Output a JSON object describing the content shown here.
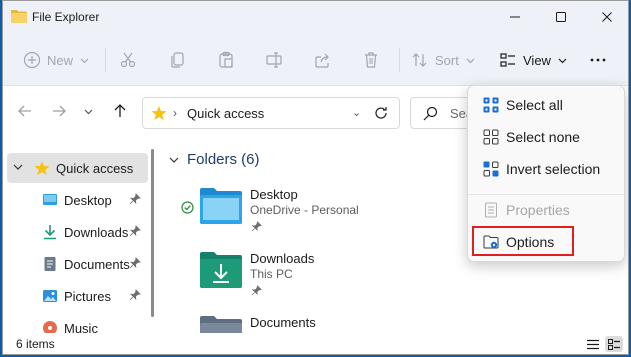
{
  "window": {
    "title": "File Explorer",
    "app_icon": "folder-icon"
  },
  "toolbar": {
    "new_label": "New",
    "sort_label": "Sort",
    "view_label": "View",
    "icons": [
      "cut-icon",
      "copy-icon",
      "paste-icon",
      "rename-icon",
      "share-icon",
      "delete-icon",
      "more-icon"
    ]
  },
  "address": {
    "path": "Quick access",
    "search_placeholder": "Sea"
  },
  "sidebar": {
    "items": [
      {
        "label": "Quick access",
        "icon": "star-icon"
      },
      {
        "label": "Desktop",
        "icon": "desktop-icon"
      },
      {
        "label": "Downloads",
        "icon": "download-icon"
      },
      {
        "label": "Documents",
        "icon": "document-icon"
      },
      {
        "label": "Pictures",
        "icon": "pictures-icon"
      },
      {
        "label": "Music",
        "icon": "music-icon"
      }
    ]
  },
  "content": {
    "section_title": "Folders (6)",
    "folders": [
      {
        "name": "Desktop",
        "sub": "OneDrive - Personal"
      },
      {
        "name": "Downloads",
        "sub": "This PC"
      },
      {
        "name": "Documents",
        "sub": ""
      }
    ]
  },
  "status": {
    "items_count": "6 items"
  },
  "menu": {
    "items": [
      {
        "label": "Select all",
        "icon": "select-all-icon"
      },
      {
        "label": "Select none",
        "icon": "select-none-icon"
      },
      {
        "label": "Invert selection",
        "icon": "invert-selection-icon"
      },
      {
        "label": "Properties",
        "icon": "properties-icon",
        "disabled": true
      },
      {
        "label": "Options",
        "icon": "options-icon",
        "highlighted": true
      }
    ]
  },
  "colors": {
    "accent": "#0067c0",
    "folder_blue": "#2b9fe0",
    "folder_green": "#1d9a77",
    "star": "#f5c211",
    "highlight": "#e02020"
  }
}
